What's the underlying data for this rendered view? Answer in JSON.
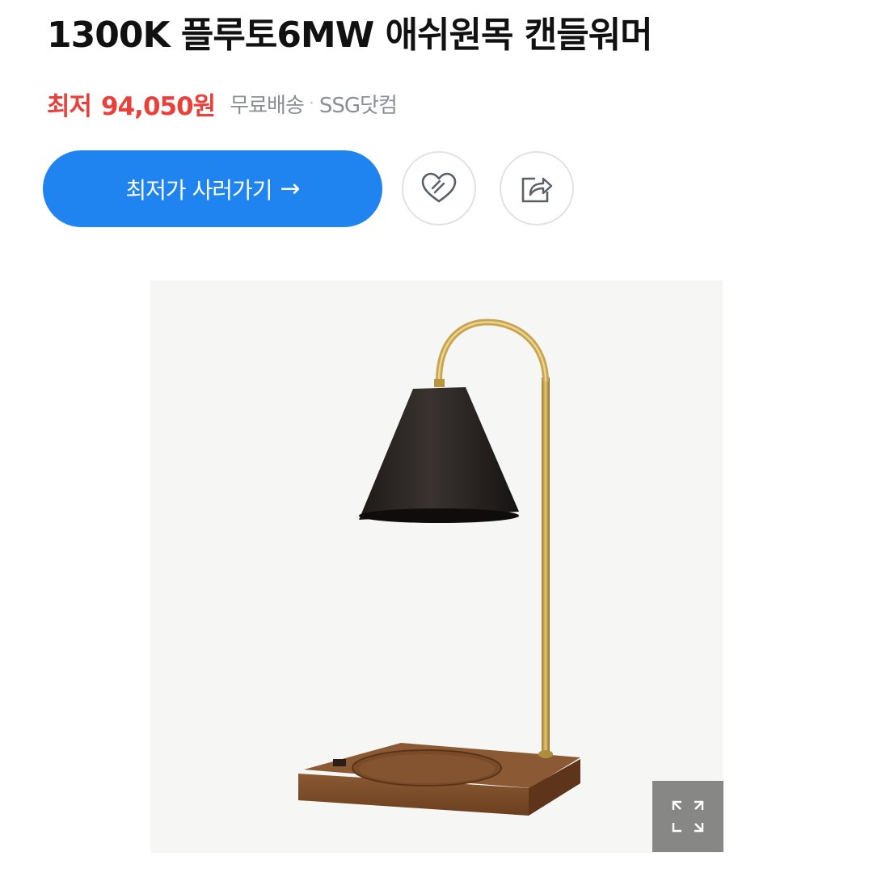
{
  "product": {
    "title": "1300K 플루토6MW 애쉬원목 캔들워머",
    "price_label": "최저",
    "price_value": "94,050원",
    "shipping": "무료배송",
    "separator": "·",
    "seller": "SSG닷컴"
  },
  "actions": {
    "buy_label": "최저가 사러가기",
    "buy_arrow": "→",
    "like_icon": "heart-icon",
    "share_icon": "share-icon",
    "expand_icon": "expand-icon"
  },
  "colors": {
    "price": "#e8403a",
    "accent": "#1f84ef",
    "muted": "#8a8f96"
  }
}
